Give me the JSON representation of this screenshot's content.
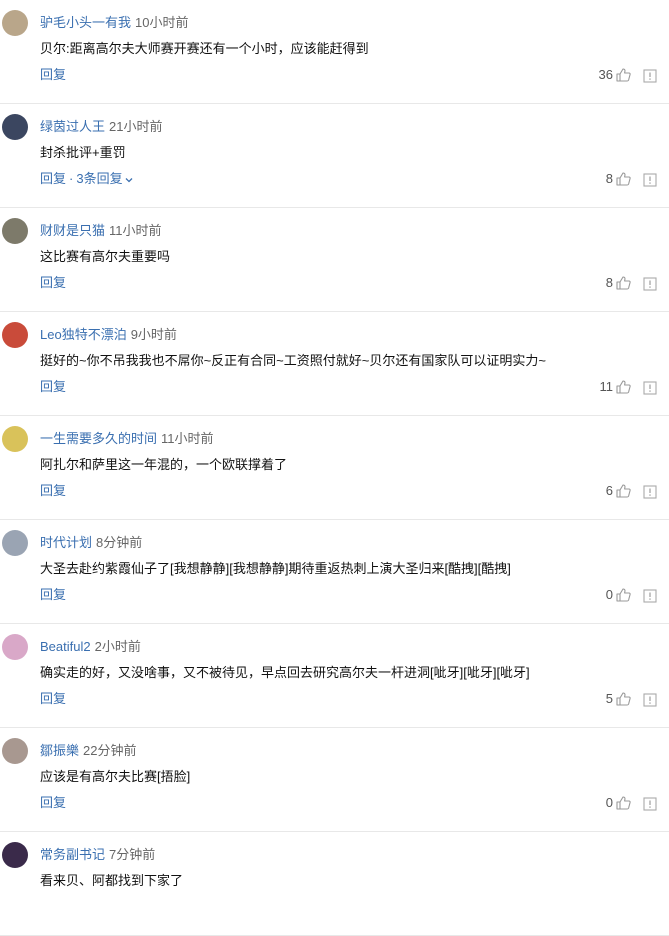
{
  "comments": [
    {
      "username": "驴毛小头一有我",
      "time": "10小时前",
      "text": "贝尔:距离高尔夫大师赛开赛还有一个小时，应该能赶得到",
      "reply": "回复",
      "replies": "",
      "likes": "36",
      "avatar_color": "#b9a68a"
    },
    {
      "username": "绿茵过人王",
      "time": "21小时前",
      "text": "封杀批评+重罚",
      "reply": "回复",
      "replies": "3条回复",
      "likes": "8",
      "avatar_color": "#3b4660"
    },
    {
      "username": "财财是只猫",
      "time": "11小时前",
      "text": "这比赛有高尔夫重要吗",
      "reply": "回复",
      "replies": "",
      "likes": "8",
      "avatar_color": "#7d7a6a"
    },
    {
      "username": "Leo独特不漂泊",
      "time": "9小时前",
      "text": "挺好的~你不吊我我也不屌你~反正有合同~工资照付就好~贝尔还有国家队可以证明实力~",
      "reply": "回复",
      "replies": "",
      "likes": "11",
      "avatar_color": "#c94b3a"
    },
    {
      "username": "一生需要多久的时间",
      "time": "11小时前",
      "text": "阿扎尔和萨里这一年混的，一个欧联撑着了",
      "reply": "回复",
      "replies": "",
      "likes": "6",
      "avatar_color": "#d9c25a"
    },
    {
      "username": "时代计划",
      "time": "8分钟前",
      "text": "大圣去赴约紫霞仙子了[我想静静][我想静静]期待重返热刺上演大圣归来[酷拽][酷拽]",
      "reply": "回复",
      "replies": "",
      "likes": "0",
      "avatar_color": "#9aa4b3"
    },
    {
      "username": "Beatiful2",
      "time": "2小时前",
      "text": "确实走的好，又没啥事，又不被待见，早点回去研究高尔夫一杆进洞[呲牙][呲牙][呲牙]",
      "reply": "回复",
      "replies": "",
      "likes": "5",
      "avatar_color": "#d9a8c8"
    },
    {
      "username": "鄒振樂",
      "time": "22分钟前",
      "text": "应该是有高尔夫比赛[捂脸]",
      "reply": "回复",
      "replies": "",
      "likes": "0",
      "avatar_color": "#a89890"
    },
    {
      "username": "常务副书记",
      "time": "7分钟前",
      "text": "看来贝、阿都找到下家了",
      "reply": "",
      "replies": "",
      "likes": "",
      "avatar_color": "#3a2a4a"
    }
  ]
}
